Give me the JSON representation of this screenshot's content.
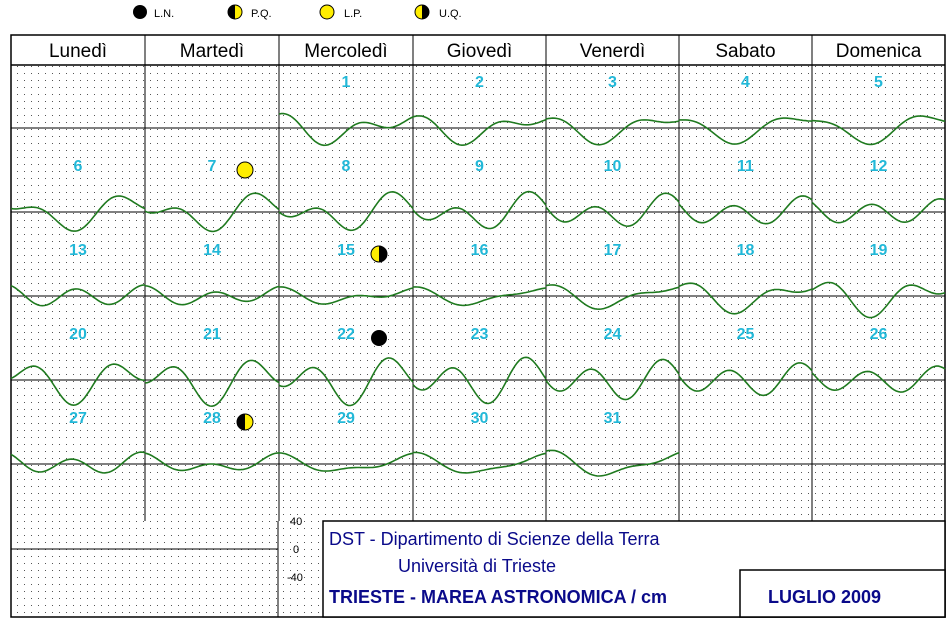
{
  "colors": {
    "grid": "#000000",
    "curve": "#1f7a1f",
    "day_number": "#22b8d8",
    "info_text": "#0a0a8a",
    "moon_yellow": "#ffee00",
    "moon_dark": "#000000"
  },
  "legend": [
    {
      "phase": "new",
      "label": "L.N."
    },
    {
      "phase": "first_quarter",
      "label": "P.Q."
    },
    {
      "phase": "full",
      "label": "L.P."
    },
    {
      "phase": "last_quarter",
      "label": "U.Q."
    }
  ],
  "weekdays": [
    "Lunedì",
    "Martedì",
    "Mercoledì",
    "Giovedì",
    "Venerdì",
    "Sabato",
    "Domenica"
  ],
  "info": {
    "line1": "DST  -  Dipartimento  di  Scienze  della  Terra",
    "line2": "Università  di  Trieste",
    "title": "TRIESTE - MAREA ASTRONOMICA / cm",
    "month": "LUGLIO  2009"
  },
  "chart_data": {
    "type": "line",
    "title": "TRIESTE - MAREA ASTRONOMICA / cm",
    "month": "LUGLIO  2009",
    "y_ticks": [
      "40",
      "0",
      "-40"
    ],
    "ylim": [
      -40,
      40
    ],
    "days": [
      {
        "day": "1",
        "weekday": 2,
        "week": 0
      },
      {
        "day": "2",
        "weekday": 3,
        "week": 0
      },
      {
        "day": "3",
        "weekday": 4,
        "week": 0
      },
      {
        "day": "4",
        "weekday": 5,
        "week": 0
      },
      {
        "day": "5",
        "weekday": 6,
        "week": 0
      },
      {
        "day": "6",
        "weekday": 0,
        "week": 1
      },
      {
        "day": "7",
        "weekday": 1,
        "week": 1
      },
      {
        "day": "8",
        "weekday": 2,
        "week": 1
      },
      {
        "day": "9",
        "weekday": 3,
        "week": 1
      },
      {
        "day": "10",
        "weekday": 4,
        "week": 1
      },
      {
        "day": "11",
        "weekday": 5,
        "week": 1
      },
      {
        "day": "12",
        "weekday": 6,
        "week": 1
      },
      {
        "day": "13",
        "weekday": 0,
        "week": 2
      },
      {
        "day": "14",
        "weekday": 1,
        "week": 2
      },
      {
        "day": "15",
        "weekday": 2,
        "week": 2
      },
      {
        "day": "16",
        "weekday": 3,
        "week": 2
      },
      {
        "day": "17",
        "weekday": 4,
        "week": 2
      },
      {
        "day": "18",
        "weekday": 5,
        "week": 2
      },
      {
        "day": "19",
        "weekday": 6,
        "week": 2
      },
      {
        "day": "20",
        "weekday": 0,
        "week": 3
      },
      {
        "day": "21",
        "weekday": 1,
        "week": 3
      },
      {
        "day": "22",
        "weekday": 2,
        "week": 3
      },
      {
        "day": "23",
        "weekday": 3,
        "week": 3
      },
      {
        "day": "24",
        "weekday": 4,
        "week": 3
      },
      {
        "day": "25",
        "weekday": 5,
        "week": 3
      },
      {
        "day": "26",
        "weekday": 6,
        "week": 3
      },
      {
        "day": "27",
        "weekday": 0,
        "week": 4
      },
      {
        "day": "28",
        "weekday": 1,
        "week": 4
      },
      {
        "day": "29",
        "weekday": 2,
        "week": 4
      },
      {
        "day": "30",
        "weekday": 3,
        "week": 4
      },
      {
        "day": "31",
        "weekday": 4,
        "week": 4
      }
    ],
    "moon_phases": [
      {
        "day": "7",
        "phase": "full"
      },
      {
        "day": "15",
        "phase": "last_quarter"
      },
      {
        "day": "22",
        "phase": "new"
      },
      {
        "day": "28",
        "phase": "first_quarter"
      }
    ],
    "tide_model": {
      "unit": "cm",
      "mean_level": 0,
      "semidiurnal_amplitude_by_day": [
        12,
        10,
        8,
        6,
        6,
        11,
        14,
        16,
        17,
        17,
        16,
        15,
        13,
        10,
        6,
        4,
        6,
        10,
        14,
        18,
        21,
        23,
        24,
        22,
        19,
        16,
        12,
        8,
        5,
        4,
        6
      ],
      "diurnal_amplitude_by_day": [
        14,
        15,
        16,
        17,
        18,
        18,
        17,
        15,
        13,
        10,
        7,
        4,
        3,
        5,
        8,
        11,
        14,
        16,
        17,
        18,
        17,
        15,
        12,
        9,
        6,
        4,
        5,
        8,
        11,
        13,
        15
      ],
      "semidiurnal_period_hours": 12.42,
      "diurnal_period_hours": 24.07
    }
  }
}
